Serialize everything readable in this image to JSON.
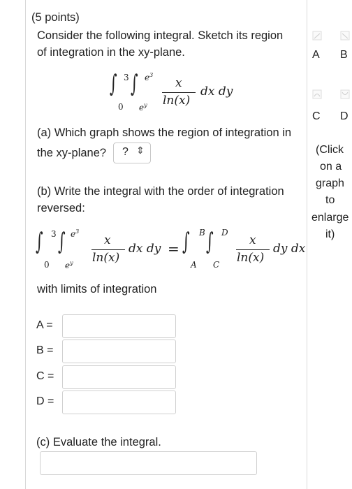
{
  "header": {
    "points": "(5 points)"
  },
  "prompt": {
    "line1": "Consider the following integral. Sketch its region",
    "line2": "of integration in the xy-plane."
  },
  "integral": {
    "outer_lower": "0",
    "outer_upper": "3",
    "inner_lower": "e",
    "inner_lower_exp": "y",
    "inner_upper": "e",
    "inner_upper_exp": "3",
    "numerator": "x",
    "denominator": "ln(x)",
    "differentials": "dx dy"
  },
  "part_a": {
    "line1": "(a) Which graph shows the region of integration in",
    "line2": "the xy-plane?",
    "select_value": "?",
    "chevron_icon": "up-down-chevron-icon"
  },
  "part_b": {
    "line1": "(b) Write the integral with the order of integration",
    "line2": "reversed:",
    "rhs_lower_outer": "A",
    "rhs_upper_outer": "B",
    "rhs_lower_inner": "C",
    "rhs_upper_inner": "D",
    "lhs_differentials": "dx dy",
    "rhs_differentials": "dy dx",
    "equals": "=",
    "limits_label": "with limits of integration",
    "fields": [
      {
        "label": "A =",
        "value": ""
      },
      {
        "label": "B =",
        "value": ""
      },
      {
        "label": "C =",
        "value": ""
      },
      {
        "label": "D =",
        "value": ""
      }
    ]
  },
  "part_c": {
    "label": "(c) Evaluate the integral.",
    "value": ""
  },
  "graphs": {
    "labels": [
      "A",
      "B",
      "C",
      "D"
    ],
    "hint": [
      "(Click",
      "on a",
      "graph",
      "to",
      "enlarge",
      "it)"
    ]
  }
}
